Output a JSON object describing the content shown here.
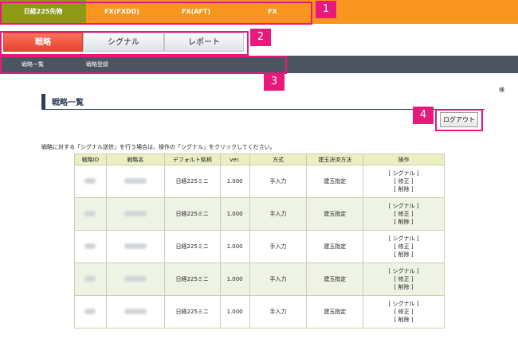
{
  "top_tabs": [
    "日経225先物",
    "FX(FXDD)",
    "FX(AFT)",
    "FX"
  ],
  "sub_tabs": [
    "戦略",
    "シグナル",
    "レポート"
  ],
  "nav_links": [
    "戦略一覧",
    "戦略登録"
  ],
  "annotations": [
    "1",
    "2",
    "3",
    "4"
  ],
  "user_label": "様",
  "heading": "戦略一覧",
  "logout_label": "ログアウト",
  "instruction": "戦略に対する「シグナル送信」を行う場合は、操作の「シグナル」をクリックしてください。",
  "table": {
    "headers": [
      "戦略ID",
      "戦略名",
      "デフォルト銘柄",
      "ver.",
      "方式",
      "建玉決済方法",
      "操作"
    ],
    "rows": [
      {
        "symbol": "日経225ミニ",
        "ver": "1.000",
        "method": "手入力",
        "settle": "建玉指定",
        "ops": [
          "[ シグナル ]",
          "[ 修正 ]",
          "[ 削除 ]"
        ]
      },
      {
        "symbol": "日経225ミニ",
        "ver": "1.000",
        "method": "手入力",
        "settle": "建玉指定",
        "ops": [
          "[ シグナル ]",
          "[ 修正 ]",
          "[ 削除 ]"
        ]
      },
      {
        "symbol": "日経225ミニ",
        "ver": "1.000",
        "method": "手入力",
        "settle": "建玉指定",
        "ops": [
          "[ シグナル ]",
          "[ 修正 ]",
          "[ 削除 ]"
        ]
      },
      {
        "symbol": "日経225ミニ",
        "ver": "1.000",
        "method": "手入力",
        "settle": "建玉指定",
        "ops": [
          "[ シグナル ]",
          "[ 修正 ]",
          "[ 削除 ]"
        ]
      },
      {
        "symbol": "日経225ミニ",
        "ver": "1.000",
        "method": "手入力",
        "settle": "建玉指定",
        "ops": [
          "[ シグナル ]",
          "[ 修正 ]",
          "[ 削除 ]"
        ]
      }
    ]
  },
  "colors": {
    "top_bar": "#f7951e",
    "active_product": "#8c9a16",
    "active_tab": "#e8412b",
    "nav_bar": "#4b5560",
    "annotation": "#e8197a",
    "heading": "#2d3e58",
    "table_header": "#ecefc4"
  }
}
